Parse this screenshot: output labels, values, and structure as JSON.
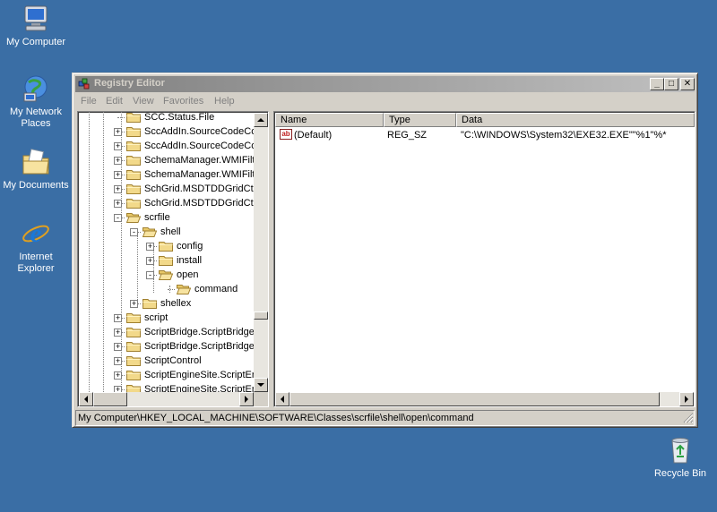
{
  "desktop": {
    "icons": [
      {
        "label_lines": [
          "My Computer"
        ],
        "icon": "my-computer-icon"
      },
      {
        "label_lines": [
          "My Network",
          "Places"
        ],
        "icon": "network-places-icon"
      },
      {
        "label_lines": [
          "My Documents"
        ],
        "icon": "my-documents-icon"
      },
      {
        "label_lines": [
          "Internet",
          "Explorer"
        ],
        "icon": "internet-explorer-icon"
      },
      {
        "label_lines": [
          "Recycle Bin"
        ],
        "icon": "recycle-bin-icon"
      }
    ]
  },
  "window": {
    "title": "Registry Editor",
    "controls": {
      "minimize": "_",
      "maximize": "□",
      "close": "✕"
    },
    "menu": [
      "File",
      "Edit",
      "View",
      "Favorites",
      "Help"
    ]
  },
  "tree": {
    "items": [
      {
        "label": "SCC.Status.File",
        "expander": ""
      },
      {
        "label": "SccAddIn.SourceCodeCo",
        "expander": "+"
      },
      {
        "label": "SccAddIn.SourceCodeCo",
        "expander": "+"
      },
      {
        "label": "SchemaManager.WMIFilt",
        "expander": "+"
      },
      {
        "label": "SchemaManager.WMIFilt",
        "expander": "+"
      },
      {
        "label": "SchGrid.MSDTDDGridCtrl",
        "expander": "+"
      },
      {
        "label": "SchGrid.MSDTDDGridCtrl",
        "expander": "+"
      },
      {
        "label": "scrfile",
        "expander": "-"
      },
      {
        "label": "shell",
        "expander": "-"
      },
      {
        "label": "config",
        "expander": "+"
      },
      {
        "label": "install",
        "expander": "+"
      },
      {
        "label": "open",
        "expander": "-"
      },
      {
        "label": "command",
        "expander": ""
      },
      {
        "label": "shellex",
        "expander": "+"
      },
      {
        "label": "script",
        "expander": "+"
      },
      {
        "label": "ScriptBridge.ScriptBridge",
        "expander": "+"
      },
      {
        "label": "ScriptBridge.ScriptBridge",
        "expander": "+"
      },
      {
        "label": "ScriptControl",
        "expander": "+"
      },
      {
        "label": "ScriptEngineSite.ScriptEr",
        "expander": "+"
      },
      {
        "label": "ScriptEngineSite.ScriptEr",
        "expander": "+"
      }
    ]
  },
  "list": {
    "columns": [
      "Name",
      "Type",
      "Data"
    ],
    "rows": [
      {
        "name": "(Default)",
        "type": "REG_SZ",
        "data": "\"C:\\WINDOWS\\System32\\EXE32.EXE\"\"%1\"%*",
        "icon": "string-value-icon",
        "icon_text": "ab"
      }
    ]
  },
  "statusbar": {
    "path": "My Computer\\HKEY_LOCAL_MACHINE\\SOFTWARE\\Classes\\scrfile\\shell\\open\\command"
  },
  "colors": {
    "desktop": "#3a6ea5",
    "inactive_title_start": "#808080",
    "inactive_title_end": "#c0c0c0",
    "face": "#d4d0c8",
    "folder": "#f2d98a"
  }
}
